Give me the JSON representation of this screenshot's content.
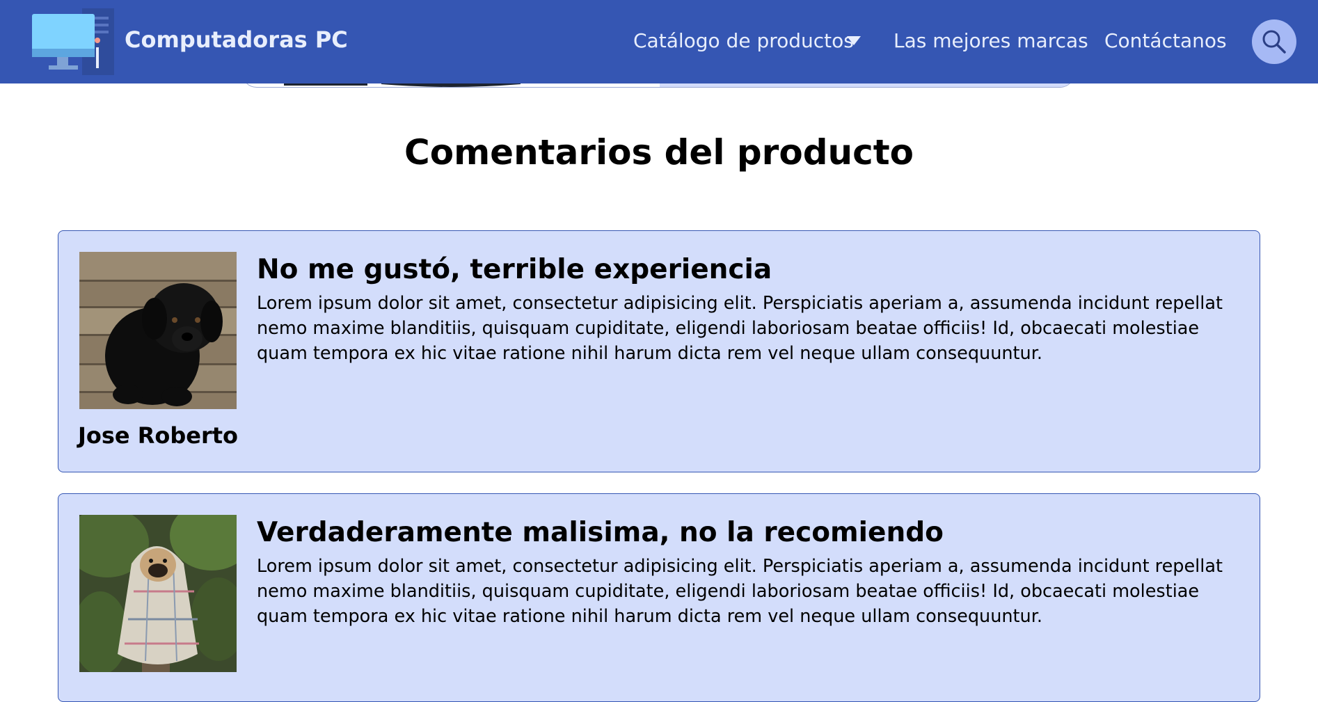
{
  "header": {
    "brand": "Computadoras PC",
    "nav": {
      "catalog": "Catálogo de productos",
      "brands": "Las mejores marcas",
      "contact": "Contáctanos"
    },
    "colors": {
      "bar": "#3556b3",
      "text": "#e8eefc",
      "search_bg": "#a6b9f5"
    }
  },
  "section": {
    "title": "Comentarios del producto"
  },
  "reviews": [
    {
      "title": "No me gustó, terrible experiencia",
      "body": "Lorem ipsum dolor sit amet, consectetur adipisicing elit. Perspiciatis aperiam a, assumenda incidunt repellat nemo maxime blanditiis, quisquam cupiditate, eligendi laboriosam beatae officiis! Id, obcaecati molestiae quam tempora ex hic vitae ratione nihil harum dicta rem vel neque ullam consequuntur.",
      "author": "Jose Roberto",
      "avatar": "black-puppy-photo"
    },
    {
      "title": "Verdaderamente malisima, no la recomiendo",
      "body": "Lorem ipsum dolor sit amet, consectetur adipisicing elit. Perspiciatis aperiam a, assumenda incidunt repellat nemo maxime blanditiis, quisquam cupiditate, eligendi laboriosam beatae officiis! Id, obcaecati molestiae quam tempora ex hic vitae ratione nihil harum dicta rem vel neque ullam consequuntur.",
      "avatar": "pug-in-blanket-photo"
    }
  ],
  "icons": {
    "logo": "computer-monitor-icon",
    "caret": "caret-down-icon",
    "search": "search-icon"
  }
}
